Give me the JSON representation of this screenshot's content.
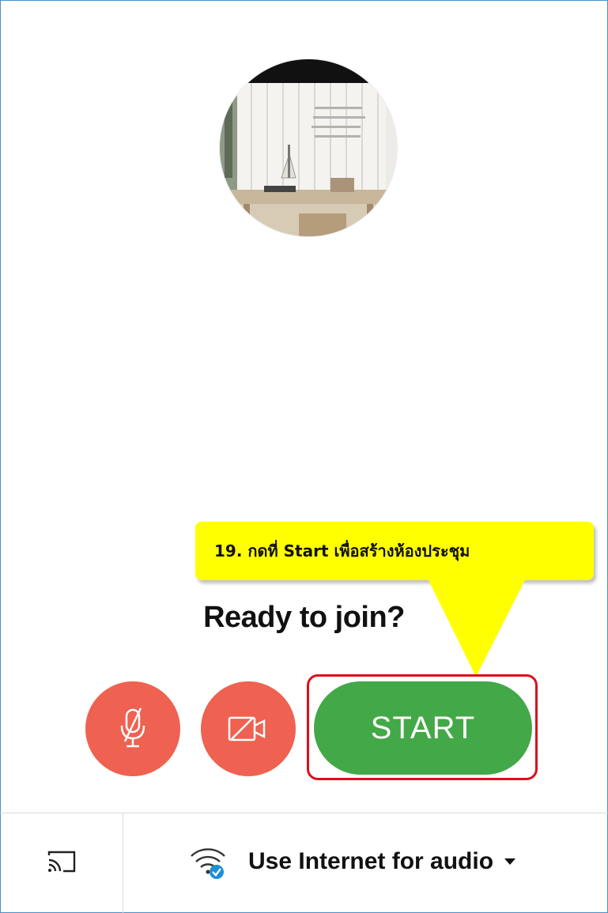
{
  "preview": {
    "title": "Ready to join?"
  },
  "controls": {
    "mic_icon": "mic-off-icon",
    "camera_icon": "camera-off-icon",
    "start_label": "START"
  },
  "annotation": {
    "text": "19. กดที่ Start เพื่อสร้างห้องประชุม"
  },
  "footer": {
    "cast_icon": "cast-icon",
    "audio_label": "Use Internet for audio",
    "audio_icon": "wifi-icon"
  },
  "colors": {
    "danger_button": "#ef6150",
    "start_button": "#43a847",
    "callout": "#ffff00",
    "highlight_border": "#d9101d"
  }
}
